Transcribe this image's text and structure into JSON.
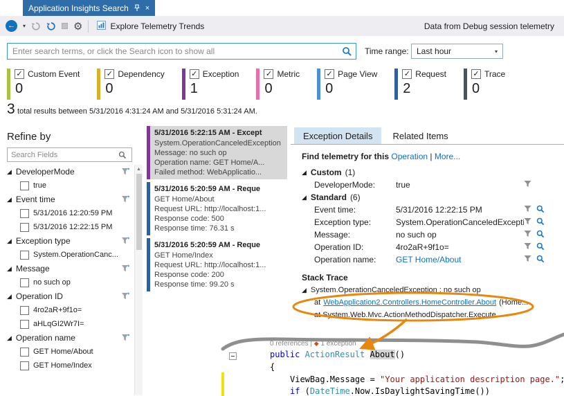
{
  "tab": {
    "title": "Application Insights Search"
  },
  "icons": {
    "close": "×",
    "caret": "▾",
    "check": "✓",
    "expander": "◢",
    "up_arrow": "▲",
    "back_arrow": "←",
    "gear": "⚙",
    "diamond": "◆"
  },
  "toolbar": {
    "explore": "Explore Telemetry Trends",
    "data_from": "Data from",
    "data_source": "Debug session telemetry"
  },
  "search": {
    "placeholder": "Enter search terms, or click the Search icon to show all",
    "time_range_label": "Time range:",
    "time_range_value": "Last hour"
  },
  "filters": [
    {
      "label": "Custom Event",
      "count": "0",
      "color": "#A9C23F"
    },
    {
      "label": "Dependency",
      "count": "0",
      "color": "#D9B126"
    },
    {
      "label": "Exception",
      "count": "1",
      "color": "#7C3A96"
    },
    {
      "label": "Metric",
      "count": "0",
      "color": "#EA6EA9"
    },
    {
      "label": "Page View",
      "count": "0",
      "color": "#4A90D9"
    },
    {
      "label": "Request",
      "count": "2",
      "color": "#30609C"
    },
    {
      "label": "Trace",
      "count": "0",
      "color": "#4A545C"
    }
  ],
  "summary": {
    "count": "3",
    "text": "total results between 5/31/2016 4:31:24 AM and 5/31/2016 5:31:24 AM."
  },
  "refine": {
    "title": "Refine by",
    "search_placeholder": "Search Fields",
    "groups": [
      {
        "label": "DeveloperMode",
        "options": [
          "true"
        ]
      },
      {
        "label": "Event time",
        "options": [
          "5/31/2016 12:20:59 PM",
          "5/31/2016 12:22:15 PM"
        ]
      },
      {
        "label": "Exception type",
        "options": [
          "System.OperationCanc..."
        ]
      },
      {
        "label": "Message",
        "options": [
          "no such op"
        ]
      },
      {
        "label": "Operation ID",
        "options": [
          "4ro2aR+9f1o=",
          "aHLqGI2Wr7I="
        ]
      },
      {
        "label": "Operation name",
        "options": [
          "GET Home/About",
          "GET Home/Index"
        ]
      }
    ]
  },
  "results": [
    {
      "color": "#7C3A96",
      "title": "5/31/2016 5:22:15 AM - Except",
      "l1": "System.OperationCanceledException",
      "l2": "Message: no such op",
      "l3": "Operation name: GET Home/A...",
      "l4": "Failed method: WebApplicatio..."
    },
    {
      "color": "#30609C",
      "title": "5/31/2016 5:20:59 AM - Reque",
      "l1": "GET Home/About",
      "l2": "Request URL: http://localhost:1...",
      "l3": "Response code: 500",
      "l4": "Response time: 76.31 s"
    },
    {
      "color": "#30609C",
      "title": "5/31/2016 5:20:59 AM - Reque",
      "l1": "GET Home/Index",
      "l2": "Request URL: http://localhost:1...",
      "l3": "Response code: 200",
      "l4": "Response time: 99.20 s"
    }
  ],
  "details": {
    "tab_exception": "Exception Details",
    "tab_related": "Related Items",
    "find_prefix": "Find telemetry for this",
    "link_operation": "Operation",
    "find_sep": "|",
    "link_more": "More...",
    "custom_label": "Custom",
    "custom_count": "(1)",
    "custom_row": {
      "label": "DeveloperMode:",
      "value": "true"
    },
    "standard_label": "Standard",
    "standard_count": "(6)",
    "rows": [
      {
        "label": "Event time:",
        "value": "5/31/2016 12:22:15 PM"
      },
      {
        "label": "Exception type:",
        "value": "System.OperationCanceledException"
      },
      {
        "label": "Message:",
        "value": "no such op"
      },
      {
        "label": "Operation ID:",
        "value": "4ro2aR+9f1o="
      },
      {
        "label": "Operation name:",
        "value": "GET Home/About"
      }
    ],
    "stack_title": "Stack Trace",
    "stack_line1": "System.OperationCanceledException : no such op",
    "stack_at": "at",
    "stack_link": "WebApplication2.Controllers.HomeController.About",
    "stack_after": "(Home...",
    "stack_line3": "at  System.Web.Mvc.ActionMethodDispatcher.Execute"
  },
  "code": {
    "refs": "0 references",
    "sep": "|",
    "exc": "1 exception",
    "kw_public": "public ",
    "type_actionresult": "ActionResult ",
    "name_about": "About",
    "parens": "()",
    "brace": "{",
    "stmt_prefix": "ViewBag.Message = ",
    "stmt_string": "\"Your application description page.\"",
    "stmt_end": ";",
    "kw_if": "if",
    "if_open": " (",
    "type_datetime": "DateTime",
    "if_rest": ".Now.IsDaylightSavingTime())"
  }
}
